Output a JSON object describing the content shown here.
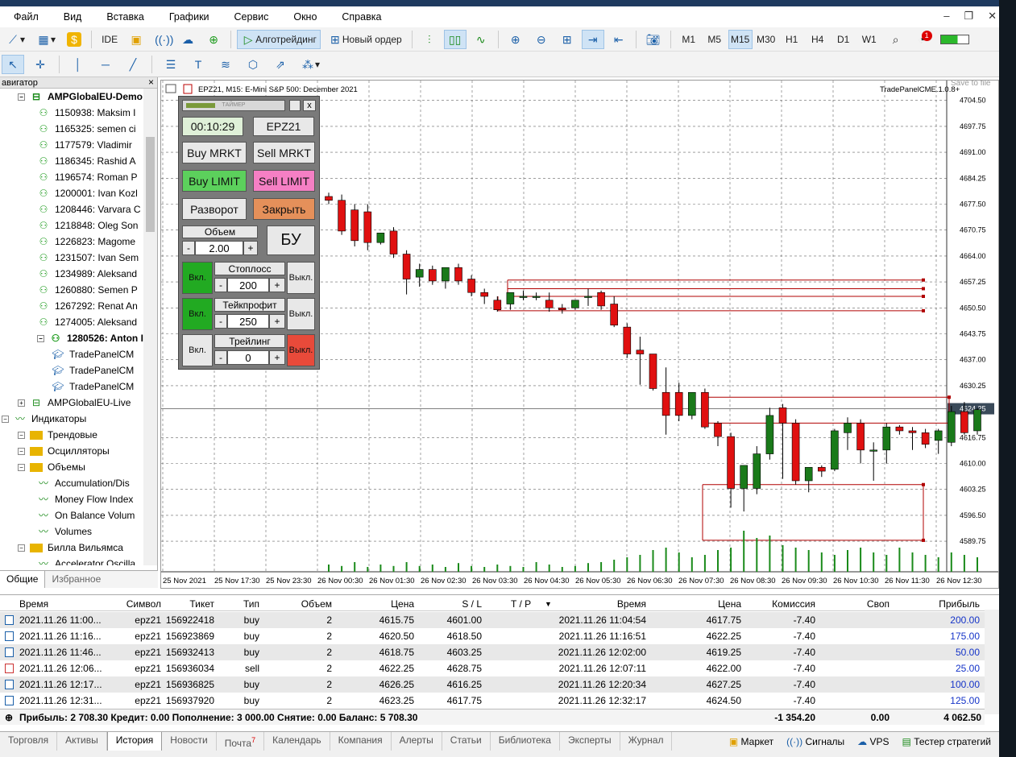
{
  "app": {
    "title_strip": "",
    "accent": "#1a5fa8"
  },
  "menu": [
    "Файл",
    "Вид",
    "Вставка",
    "Графики",
    "Сервис",
    "Окно",
    "Справка"
  ],
  "toolbar": {
    "ide_label": "IDE",
    "algotrading_label": "Алготрейдинг",
    "new_order_label": "Новый ордер",
    "timeframes": [
      "M1",
      "M5",
      "M15",
      "M30",
      "H1",
      "H4",
      "D1",
      "W1"
    ],
    "active_timeframe": "M15",
    "notifications_badge": "1"
  },
  "navigator": {
    "header": "авигатор",
    "items": [
      {
        "label": "AMPGlobalEU-Demo",
        "level": 1,
        "bold": true,
        "icon": "server-icon"
      },
      {
        "label": "1150938: Maksim I",
        "level": 2,
        "icon": "user-icon"
      },
      {
        "label": "1165325: semen ci",
        "level": 2,
        "icon": "user-icon"
      },
      {
        "label": "1177579: Vladimir",
        "level": 2,
        "icon": "user-icon"
      },
      {
        "label": "1186345: Rashid A",
        "level": 2,
        "icon": "user-icon"
      },
      {
        "label": "1196574: Roman P",
        "level": 2,
        "icon": "user-icon"
      },
      {
        "label": "1200001: Ivan Kozl",
        "level": 2,
        "icon": "user-icon"
      },
      {
        "label": "1208446: Varvara C",
        "level": 2,
        "icon": "user-icon"
      },
      {
        "label": "1218848: Oleg Son",
        "level": 2,
        "icon": "user-icon"
      },
      {
        "label": "1226823: Magome",
        "level": 2,
        "icon": "user-icon"
      },
      {
        "label": "1231507: Ivan Sem",
        "level": 2,
        "icon": "user-icon"
      },
      {
        "label": "1234989: Aleksand",
        "level": 2,
        "icon": "user-icon"
      },
      {
        "label": "1260880: Semen P",
        "level": 2,
        "icon": "user-icon"
      },
      {
        "label": "1267292: Renat An",
        "level": 2,
        "icon": "user-icon"
      },
      {
        "label": "1274005: Aleksand",
        "level": 2,
        "icon": "user-icon"
      },
      {
        "label": "1280526: Anton I",
        "level": 2,
        "bold": true,
        "icon": "user-icon"
      },
      {
        "label": "TradePanelCM",
        "level": 3,
        "icon": "expert-icon"
      },
      {
        "label": "TradePanelCM",
        "level": 3,
        "icon": "expert-icon"
      },
      {
        "label": "TradePanelCM",
        "level": 3,
        "icon": "expert-icon"
      },
      {
        "label": "AMPGlobalEU-Live",
        "level": 1,
        "icon": "server-icon"
      },
      {
        "label": "Индикаторы",
        "level": 0,
        "icon": "indicator-icon"
      },
      {
        "label": "Трендовые",
        "level": 1,
        "icon": "folder-icon"
      },
      {
        "label": "Осцилляторы",
        "level": 1,
        "icon": "folder-icon"
      },
      {
        "label": "Объемы",
        "level": 1,
        "icon": "folder-icon"
      },
      {
        "label": "Accumulation/Dis",
        "level": 2,
        "icon": "indicator-icon"
      },
      {
        "label": "Money Flow Index",
        "level": 2,
        "icon": "indicator-icon"
      },
      {
        "label": "On Balance Volum",
        "level": 2,
        "icon": "indicator-icon"
      },
      {
        "label": "Volumes",
        "level": 2,
        "icon": "indicator-icon"
      },
      {
        "label": "Билла Вильямса",
        "level": 1,
        "icon": "folder-icon"
      },
      {
        "label": "Accelerator Oscilla",
        "level": 2,
        "icon": "indicator-icon"
      }
    ],
    "tabs": [
      "Общие",
      "Избранное"
    ]
  },
  "chart": {
    "header": "EPZ21, M15:  E-Mini S&P 500: December 2021",
    "ea_label": "TradePanelCME.1.0.8+",
    "save_tooltip": "Save to file",
    "current_price": "4624.25",
    "price_labels": [
      "4704.50",
      "4697.75",
      "4691.00",
      "4684.25",
      "4677.50",
      "4670.75",
      "4664.00",
      "4657.25",
      "4650.50",
      "4643.75",
      "4637.00",
      "4630.25",
      "4624.25",
      "4616.75",
      "4610.00",
      "4603.25",
      "4596.50",
      "4589.75"
    ],
    "time_labels": [
      "25 Nov 2021",
      "25 Nov 17:30",
      "25 Nov 23:30",
      "26 Nov 00:30",
      "26 Nov 01:30",
      "26 Nov 02:30",
      "26 Nov 03:30",
      "26 Nov 04:30",
      "26 Nov 05:30",
      "26 Nov 06:30",
      "26 Nov 07:30",
      "26 Nov 08:30",
      "26 Nov 09:30",
      "26 Nov 10:30",
      "26 Nov 11:30",
      "26 Nov 12:30"
    ],
    "colors": {
      "bull": "#1a7a1a",
      "bear": "#e01010",
      "volume": "#1a8a1a",
      "level": "#b00000"
    }
  },
  "chart_data": {
    "type": "candlestick",
    "symbol": "EPZ21",
    "timeframe": "M15",
    "ylim": [
      4586,
      4708
    ],
    "candles": [
      {
        "o": 4679.5,
        "h": 4680.5,
        "c": 4678.5,
        "l": 4677.5
      },
      {
        "o": 4678.5,
        "h": 4680.0,
        "c": 4670.5,
        "l": 4669.5
      },
      {
        "o": 4676.0,
        "h": 4677.5,
        "c": 4668.0,
        "l": 4666.5
      },
      {
        "o": 4675.5,
        "h": 4677.5,
        "c": 4667.5,
        "l": 4665.5
      },
      {
        "o": 4667.5,
        "h": 4670.0,
        "c": 4670.0,
        "l": 4667.0
      },
      {
        "o": 4670.5,
        "h": 4671.5,
        "c": 4664.5,
        "l": 4663.5
      },
      {
        "o": 4664.5,
        "h": 4665.5,
        "c": 4658.0,
        "l": 4654.0
      },
      {
        "o": 4658.5,
        "h": 4662.0,
        "c": 4660.5,
        "l": 4656.0
      },
      {
        "o": 4660.5,
        "h": 4661.5,
        "c": 4657.5,
        "l": 4656.5
      },
      {
        "o": 4657.5,
        "h": 4661.0,
        "c": 4661.0,
        "l": 4655.5
      },
      {
        "o": 4661.0,
        "h": 4662.0,
        "c": 4657.5,
        "l": 4656.5
      },
      {
        "o": 4658.0,
        "h": 4659.0,
        "c": 4654.5,
        "l": 4653.5
      },
      {
        "o": 4654.5,
        "h": 4655.5,
        "c": 4653.5,
        "l": 4651.5
      },
      {
        "o": 4652.5,
        "h": 4653.5,
        "c": 4650.0,
        "l": 4649.5
      },
      {
        "o": 4651.5,
        "h": 4654.5,
        "c": 4654.5,
        "l": 4650.0
      },
      {
        "o": 4653.5,
        "h": 4655.0,
        "c": 4653.5,
        "l": 4652.5
      },
      {
        "o": 4653.5,
        "h": 4654.5,
        "c": 4653.5,
        "l": 4652.5
      },
      {
        "o": 4652.5,
        "h": 4654.5,
        "c": 4650.5,
        "l": 4649.5
      },
      {
        "o": 4650.5,
        "h": 4651.5,
        "c": 4650.0,
        "l": 4649.0
      },
      {
        "o": 4650.5,
        "h": 4652.5,
        "c": 4652.5,
        "l": 4650.0
      },
      {
        "o": 4653.5,
        "h": 4655.5,
        "c": 4653.5,
        "l": 4651.0
      },
      {
        "o": 4654.5,
        "h": 4655.0,
        "c": 4651.0,
        "l": 4650.0
      },
      {
        "o": 4651.5,
        "h": 4653.5,
        "c": 4646.0,
        "l": 4645.5
      },
      {
        "o": 4645.5,
        "h": 4646.5,
        "c": 4638.5,
        "l": 4637.5
      },
      {
        "o": 4639.5,
        "h": 4643.0,
        "c": 4638.5,
        "l": 4630.5
      },
      {
        "o": 4638.5,
        "h": 4638.5,
        "c": 4629.5,
        "l": 4629.0
      },
      {
        "o": 4628.5,
        "h": 4635.0,
        "c": 4622.5,
        "l": 4617.5
      },
      {
        "o": 4628.5,
        "h": 4631.0,
        "c": 4622.5,
        "l": 4621.0
      },
      {
        "o": 4622.5,
        "h": 4628.5,
        "c": 4628.5,
        "l": 4621.5
      },
      {
        "o": 4628.5,
        "h": 4629.5,
        "c": 4619.5,
        "l": 4619.0
      },
      {
        "o": 4620.5,
        "h": 4621.0,
        "c": 4617.0,
        "l": 4614.5
      },
      {
        "o": 4617.0,
        "h": 4618.0,
        "c": 4603.5,
        "l": 4598.5
      },
      {
        "o": 4603.5,
        "h": 4609.5,
        "c": 4609.5,
        "l": 4597.5
      },
      {
        "o": 4603.5,
        "h": 4614.5,
        "c": 4612.5,
        "l": 4602.0
      },
      {
        "o": 4612.5,
        "h": 4624.5,
        "c": 4622.5,
        "l": 4611.0
      },
      {
        "o": 4624.5,
        "h": 4625.5,
        "c": 4620.5,
        "l": 4606.0
      },
      {
        "o": 4620.5,
        "h": 4621.5,
        "c": 4605.5,
        "l": 4604.5
      },
      {
        "o": 4605.5,
        "h": 4609.0,
        "c": 4609.0,
        "l": 4602.5
      },
      {
        "o": 4609.0,
        "h": 4609.5,
        "c": 4608.0,
        "l": 4606.5
      },
      {
        "o": 4608.5,
        "h": 4619.0,
        "c": 4618.5,
        "l": 4608.0
      },
      {
        "o": 4618.0,
        "h": 4622.0,
        "c": 4620.5,
        "l": 4613.5
      },
      {
        "o": 4620.5,
        "h": 4621.5,
        "c": 4613.5,
        "l": 4610.0
      },
      {
        "o": 4613.5,
        "h": 4615.5,
        "c": 4613.5,
        "l": 4605.5
      },
      {
        "o": 4613.5,
        "h": 4620.5,
        "c": 4619.5,
        "l": 4610.0
      },
      {
        "o": 4619.5,
        "h": 4620.0,
        "c": 4618.5,
        "l": 4617.5
      },
      {
        "o": 4618.5,
        "h": 4619.5,
        "c": 4618.0,
        "l": 4613.5
      },
      {
        "o": 4618.0,
        "h": 4619.0,
        "c": 4615.0,
        "l": 4614.0
      },
      {
        "o": 4616.0,
        "h": 4619.0,
        "c": 4618.5,
        "l": 4612.5
      },
      {
        "o": 4615.5,
        "h": 4625.0,
        "c": 4623.5,
        "l": 4614.5
      },
      {
        "o": 4623.5,
        "h": 4626.0,
        "c": 4618.0,
        "l": 4617.5
      },
      {
        "o": 4618.5,
        "h": 4624.5,
        "c": 4624.0,
        "l": 4617.5
      }
    ],
    "volumes": [
      0.15,
      0.12,
      0.2,
      0.1,
      0.15,
      0.12,
      0.2,
      0.12,
      0.15,
      0.1,
      0.18,
      0.12,
      0.1,
      0.15,
      0.12,
      0.1,
      0.2,
      0.15,
      0.1,
      0.12,
      0.18,
      0.2,
      0.25,
      0.3,
      0.35,
      0.45,
      0.5,
      0.4,
      0.3,
      0.35,
      0.45,
      0.5,
      0.85,
      0.7,
      0.75,
      0.55,
      0.5,
      0.45,
      0.4,
      0.35,
      0.45,
      0.5,
      0.4,
      0.35,
      0.5,
      0.4,
      0.35,
      0.3,
      0.4,
      0.35,
      0.3
    ],
    "levels": [
      4657.75,
      4655.5,
      4653.5,
      4649.75,
      4627.25,
      4620.5,
      4604.5,
      4590.0
    ]
  },
  "panel": {
    "title": "ТАЙМЕР",
    "timer": "00:10:29",
    "symbol": "EPZ21",
    "buy_market": "Buy MRKT",
    "sell_market": "Sell MRKT",
    "buy_limit": "Buy LIMIT",
    "sell_limit": "Sell LIMIT",
    "reverse": "Разворот",
    "close": "Закрыть",
    "volume_label": "Объем",
    "volume_value": "2.00",
    "breakeven": "БУ",
    "stoploss_label": "Стоплосс",
    "stoploss_value": "200",
    "takeprofit_label": "Тейкпрофит",
    "takeprofit_value": "250",
    "trailing_label": "Трейлинг",
    "trailing_value": "0",
    "on": "Вкл.",
    "off": "Выкл.",
    "minus": "-",
    "plus": "+",
    "close_x": "x"
  },
  "history": {
    "columns": [
      "Время",
      "Символ",
      "Тикет",
      "Тип",
      "Объем",
      "Цена",
      "S / L",
      "T / P",
      "Время",
      "Цена",
      "Комиссия",
      "Своп",
      "Прибыль"
    ],
    "rows": [
      [
        "2021.11.26 11:00...",
        "epz21",
        "156922418",
        "buy",
        "2",
        "4615.75",
        "4601.00",
        "",
        "2021.11.26 11:04:54",
        "4617.75",
        "-7.40",
        "",
        "200.00"
      ],
      [
        "2021.11.26 11:16...",
        "epz21",
        "156923869",
        "buy",
        "2",
        "4620.50",
        "4618.50",
        "",
        "2021.11.26 11:16:51",
        "4622.25",
        "-7.40",
        "",
        "175.00"
      ],
      [
        "2021.11.26 11:46...",
        "epz21",
        "156932413",
        "buy",
        "2",
        "4618.75",
        "4603.25",
        "",
        "2021.11.26 12:02:00",
        "4619.25",
        "-7.40",
        "",
        "50.00"
      ],
      [
        "2021.11.26 12:06...",
        "epz21",
        "156936034",
        "sell",
        "2",
        "4622.25",
        "4628.75",
        "",
        "2021.11.26 12:07:11",
        "4622.00",
        "-7.40",
        "",
        "25.00"
      ],
      [
        "2021.11.26 12:17...",
        "epz21",
        "156936825",
        "buy",
        "2",
        "4626.25",
        "4616.25",
        "",
        "2021.11.26 12:20:34",
        "4627.25",
        "-7.40",
        "",
        "100.00"
      ],
      [
        "2021.11.26 12:31...",
        "epz21",
        "156937920",
        "buy",
        "2",
        "4623.25",
        "4617.75",
        "",
        "2021.11.26 12:32:17",
        "4624.50",
        "-7.40",
        "",
        "125.00"
      ]
    ],
    "summary": "Прибыль: 2 708.30  Кредит: 0.00  Пополнение: 3 000.00  Снятие: 0.00  Баланс: 5 708.30",
    "total_commission": "-1 354.20",
    "total_swap": "0.00",
    "total_profit": "4 062.50"
  },
  "bottom_tabs": [
    "Торговля",
    "Активы",
    "История",
    "Новости",
    "Почта",
    "Календарь",
    "Компания",
    "Алерты",
    "Статьи",
    "Библиотека",
    "Эксперты",
    "Журнал"
  ],
  "mail_badge": "7",
  "active_bottom_tab": "История",
  "bottom_right": {
    "market": "Маркет",
    "signals": "Сигналы",
    "vps": "VPS",
    "tester": "Тестер стратегий"
  }
}
